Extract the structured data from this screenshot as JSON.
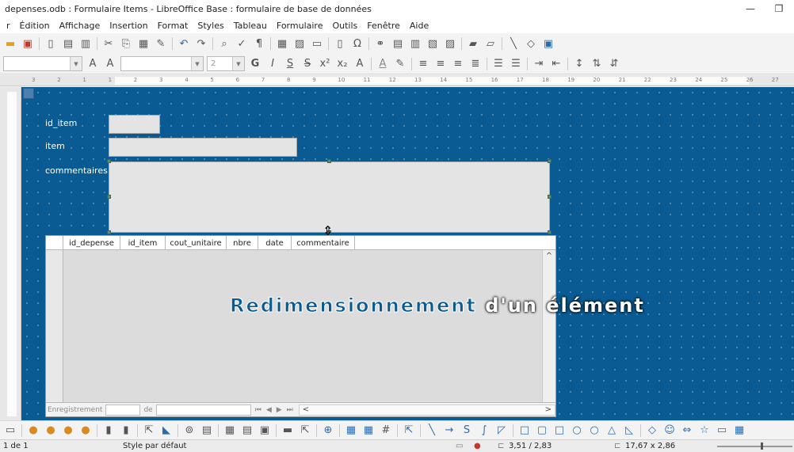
{
  "window": {
    "title": "depenses.odb : Formulaire Items - LibreOffice Base : formulaire de base de données",
    "minimize": "—",
    "restore": "❐"
  },
  "menu": [
    "r",
    "Édition",
    "Affichage",
    "Insertion",
    "Format",
    "Styles",
    "Tableau",
    "Formulaire",
    "Outils",
    "Fenêtre",
    "Aide"
  ],
  "format_bar": {
    "size_value": "2"
  },
  "ruler": {
    "ticks": [
      "3",
      "2",
      "1",
      "1",
      "2",
      "3",
      "4",
      "5",
      "6",
      "7",
      "8",
      "9",
      "10",
      "11",
      "12",
      "13",
      "14",
      "15",
      "16",
      "17",
      "18",
      "19",
      "20",
      "21",
      "22",
      "23",
      "24",
      "25",
      "26",
      "27"
    ]
  },
  "form": {
    "labels": {
      "id_item": "id_item",
      "item": "item",
      "commentaires": "commentaires"
    }
  },
  "grid": {
    "columns": [
      "id_depense",
      "id_item",
      "cout_unitaire",
      "nbre",
      "date",
      "commentaire"
    ],
    "nav_record_label": "Enregistrement",
    "nav_of_label": "de"
  },
  "caption": {
    "part1": "Redimensionnement",
    "part2": "d'un élément"
  },
  "status": {
    "page": "1 de 1",
    "style": "Style par défaut",
    "position": "3,51 / 2,83",
    "size": "17,67 x 2,86"
  },
  "colors": {
    "canvas": "#0a5b93",
    "field": "#e4e4e4"
  }
}
